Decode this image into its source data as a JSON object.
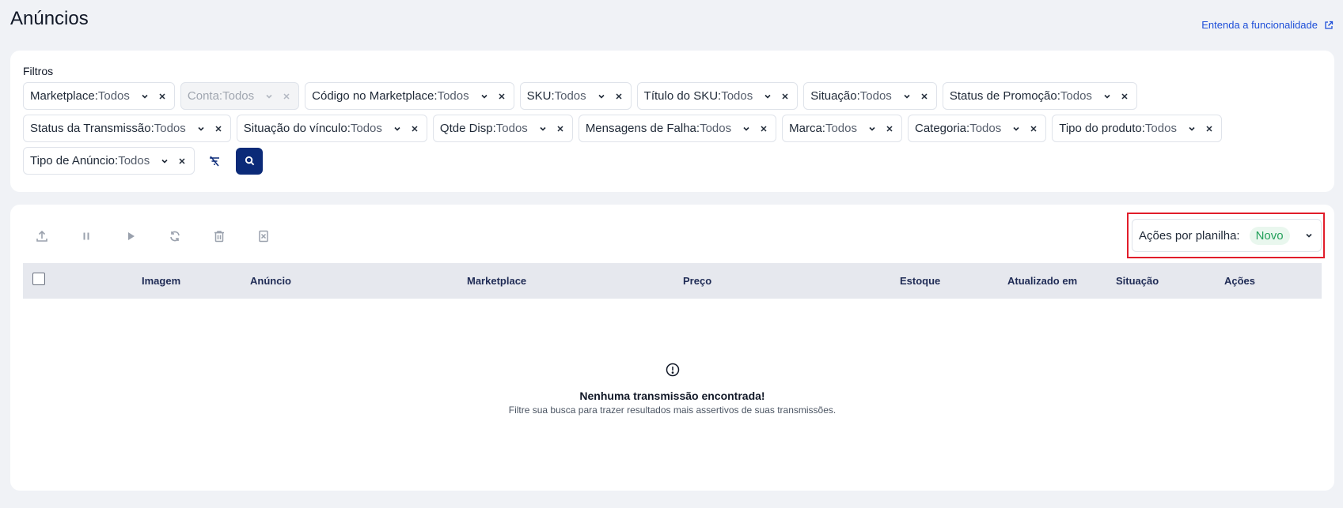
{
  "page": {
    "title": "Anúncios",
    "help_link": "Entenda a funcionalidade"
  },
  "filters": {
    "label": "Filtros",
    "rows": [
      [
        {
          "key": "Marketplace: ",
          "value": "Todos",
          "disabled": false
        },
        {
          "key": "Conta: ",
          "value": "Todos",
          "disabled": true
        },
        {
          "key": "Código no Marketplace:",
          "value": "Todos",
          "disabled": false
        },
        {
          "key": "SKU:",
          "value": "Todos",
          "disabled": false
        },
        {
          "key": "Título do SKU:",
          "value": "Todos",
          "disabled": false
        },
        {
          "key": "Situação:",
          "value": "Todos",
          "disabled": false
        },
        {
          "key": "Status de Promoção:",
          "value": "Todos",
          "disabled": false
        }
      ],
      [
        {
          "key": "Status da Transmissão:",
          "value": "Todos",
          "disabled": false
        },
        {
          "key": "Situação do vínculo:",
          "value": "Todos",
          "disabled": false
        },
        {
          "key": "Qtde Disp:",
          "value": "Todos",
          "disabled": false
        },
        {
          "key": "Mensagens de Falha: ",
          "value": "Todos",
          "disabled": false
        },
        {
          "key": "Marca:",
          "value": "Todos",
          "disabled": false
        },
        {
          "key": "Categoria:",
          "value": "Todos",
          "disabled": false
        },
        {
          "key": "Tipo do produto:",
          "value": "Todos",
          "disabled": false
        }
      ],
      [
        {
          "key": "Tipo de Anúncio:",
          "value": "Todos",
          "disabled": false
        }
      ]
    ],
    "clear_icon": "filter-clear-icon",
    "search_icon": "search-icon"
  },
  "toolbar": {
    "icons": [
      "upload-icon",
      "pause-icon",
      "play-icon",
      "sync-icon",
      "trash-icon",
      "delete-file-icon"
    ]
  },
  "actions_select": {
    "label": "Ações por planilha:",
    "badge": "Novo"
  },
  "table": {
    "columns": [
      "Imagem",
      "Anúncio",
      "Marketplace",
      "Preço",
      "Estoque",
      "Atualizado em",
      "Situação",
      "Ações"
    ]
  },
  "empty_state": {
    "title": "Nenhuma transmissão encontrada!",
    "subtitle": "Filtre sua busca para trazer resultados mais assertivos de suas transmissões."
  },
  "colors": {
    "primary": "#0b2a78",
    "link": "#1d4ed8",
    "badge_green": "#22a05a",
    "highlight_red": "#e11d2a"
  }
}
